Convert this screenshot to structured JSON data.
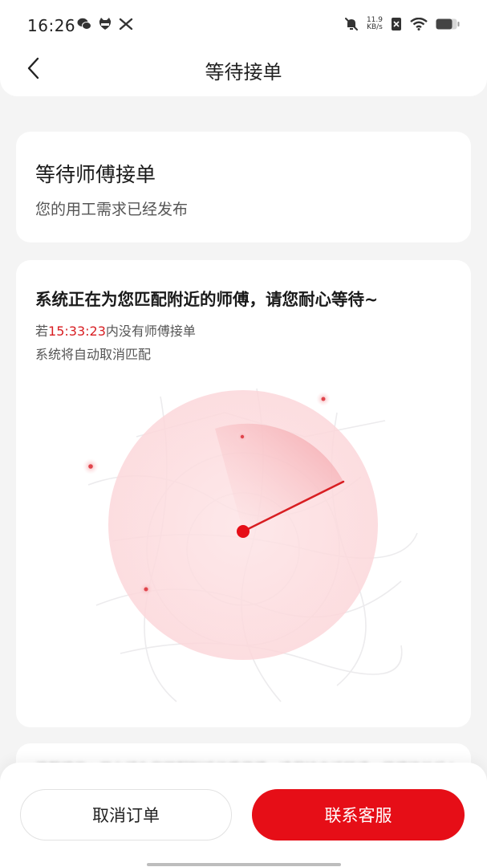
{
  "status_bar": {
    "time": "16:26",
    "net_speed_value": "11.9",
    "net_speed_unit": "KB/s",
    "left_icons": [
      "wechat-icon",
      "cat-icon",
      "tools-icon"
    ],
    "right_icons": [
      "mute-bell-icon",
      "sim-icon",
      "wifi-icon",
      "battery-icon"
    ]
  },
  "header": {
    "title": "等待接单"
  },
  "status_card": {
    "title": "等待师傅接单",
    "subtitle": "您的用工需求已经发布"
  },
  "radar_card": {
    "title": "系统正在为您匹配附近的师傅，请您耐心等待~",
    "line1_prefix": "若",
    "countdown": "15:33:23",
    "line1_suffix": "内没有师傅接单",
    "line2": "系统将自动取消匹配"
  },
  "peek_card": {
    "text": "温馨提示：平台将为您匹配附近优质师傅，请保持电话畅通，师傅接单后会与您联系确认工作详情"
  },
  "actions": {
    "cancel_label": "取消订单",
    "contact_label": "联系客服"
  },
  "colors": {
    "accent": "#e60e17",
    "countdown": "#d81e22",
    "background": "#f4f4f4"
  }
}
